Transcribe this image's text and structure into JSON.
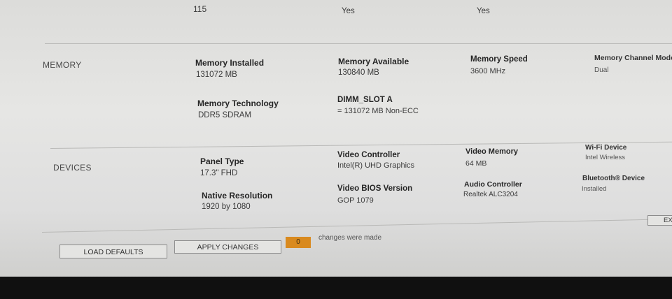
{
  "top_row": {
    "microcode_value": "115",
    "hyperthreading_value": "Yes",
    "bit64_value": "Yes"
  },
  "memory": {
    "section_title": "MEMORY",
    "installed_label": "Memory Installed",
    "installed_value": "131072 MB",
    "available_label": "Memory Available",
    "available_value": "130840 MB",
    "speed_label": "Memory Speed",
    "speed_value": "3600 MHz",
    "channel_label": "Memory Channel Mode",
    "channel_value": "Dual",
    "technology_label": "Memory Technology",
    "technology_value": "DDR5 SDRAM",
    "dimm_label": "DIMM_SLOT A",
    "dimm_value": "= 131072 MB Non-ECC"
  },
  "devices": {
    "section_title": "DEVICES",
    "panel_label": "Panel Type",
    "panel_value": "17.3\" FHD",
    "video_ctrl_label": "Video Controller",
    "video_ctrl_value": "Intel(R) UHD Graphics",
    "video_mem_label": "Video Memory",
    "video_mem_value": "64 MB",
    "wifi_label": "Wi-Fi Device",
    "wifi_value": "Intel Wireless",
    "native_res_label": "Native Resolution",
    "native_res_value": "1920 by 1080",
    "video_bios_label": "Video BIOS Version",
    "video_bios_value": "GOP 1079",
    "audio_label": "Audio Controller",
    "audio_value": "Realtek ALC3204",
    "bt_label": "Bluetooth® Device",
    "bt_value": "Installed"
  },
  "footer": {
    "load_defaults": "LOAD DEFAULTS",
    "apply_changes": "APPLY CHANGES",
    "changes_count": "0",
    "changes_text": "changes were made",
    "exit": "EXI"
  }
}
